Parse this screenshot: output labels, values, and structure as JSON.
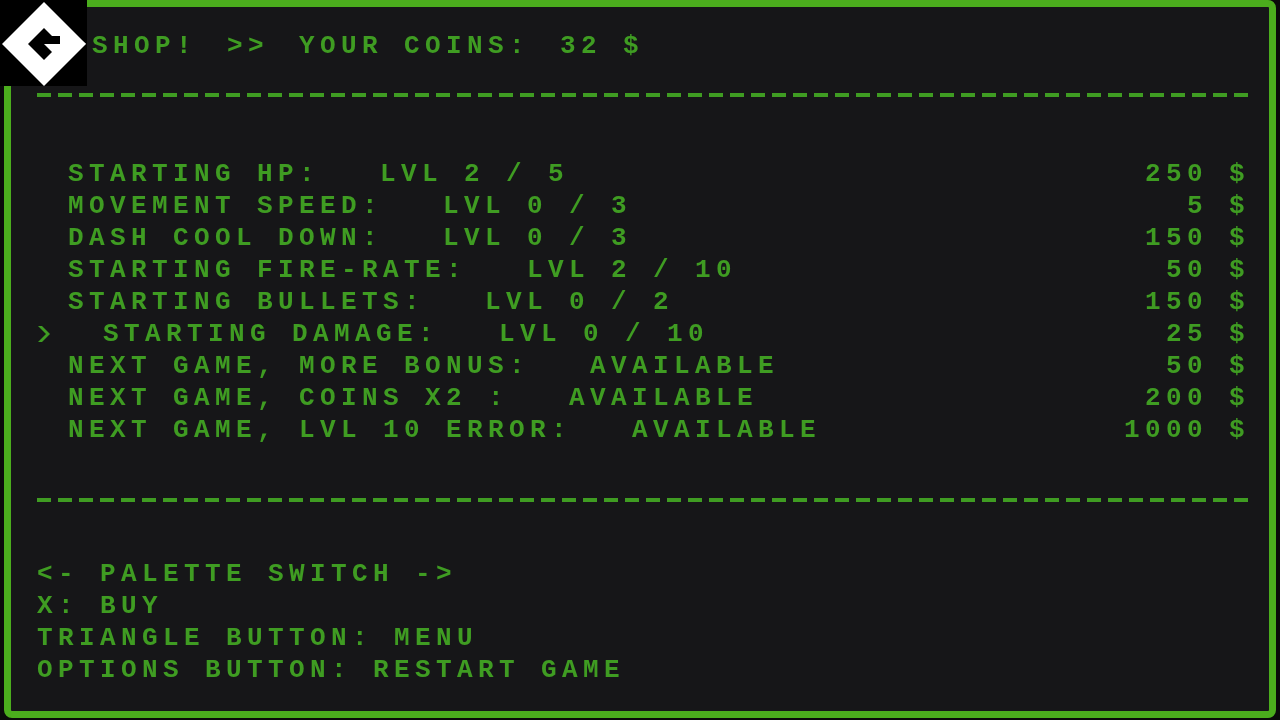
{
  "header": {
    "title": "SHOP!",
    "separator": ">>",
    "coins_label": "YOUR COINS:",
    "coins_value": "32 $"
  },
  "upgrades": [
    {
      "label": "STARTING HP:",
      "status": "LVL 2 / 5",
      "price": "250 $",
      "selected": false
    },
    {
      "label": "MOVEMENT SPEED:",
      "status": "LVL 0 / 3",
      "price": "5 $",
      "selected": false
    },
    {
      "label": "DASH COOL DOWN:",
      "status": "LVL 0 / 3",
      "price": "150 $",
      "selected": false
    },
    {
      "label": "STARTING FIRE-RATE:",
      "status": "LVL 2 / 10",
      "price": "50 $",
      "selected": false
    },
    {
      "label": "STARTING BULLETS:",
      "status": "LVL 0 / 2",
      "price": "150 $",
      "selected": false
    },
    {
      "label": "STARTING DAMAGE:",
      "status": "LVL 0 / 10",
      "price": "25 $",
      "selected": true
    },
    {
      "label": "NEXT GAME, MORE BONUS:",
      "status": "AVAILABLE",
      "price": "50 $",
      "selected": false
    },
    {
      "label": "NEXT GAME, COINS X2 :",
      "status": "AVAILABLE",
      "price": "200 $",
      "selected": false
    },
    {
      "label": "NEXT GAME, LVL 10 ERROR:",
      "status": "AVAILABLE",
      "price": "1000 $",
      "selected": false
    }
  ],
  "controls": [
    "<- PALETTE SWITCH ->",
    "X: BUY",
    "TRIANGLE BUTTON: MENU",
    "OPTIONS BUTTON: RESTART GAME"
  ]
}
